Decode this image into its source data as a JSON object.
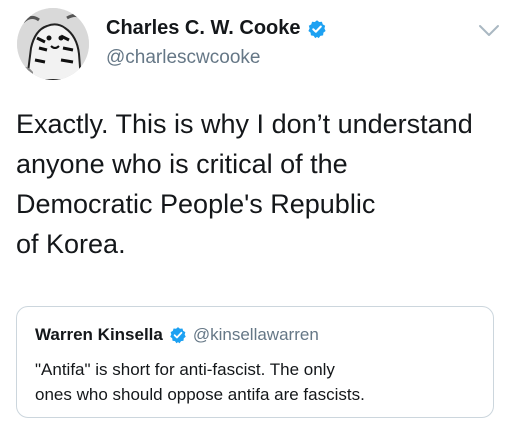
{
  "author": {
    "name": "Charles C. W. Cooke",
    "handle": "@charlescwcooke",
    "verified": true
  },
  "tweet": {
    "lines": [
      "Exactly. This is why I don’t understand",
      "anyone who is critical of the",
      "Democratic People's Republic",
      "of Korea."
    ]
  },
  "quoted_tweet": {
    "name": "Warren Kinsella",
    "handle": "@kinsellawarren",
    "verified": true,
    "lines": [
      "\"Antifa\" is short for anti-fascist. The only",
      "ones who should oppose antifa are fascists."
    ]
  },
  "colors": {
    "verified_blue": "#1da1f2",
    "handle_gray": "#657786",
    "text": "#14171a",
    "border": "#ccd6dd"
  },
  "icons": {
    "verified": "verified-badge-icon",
    "more": "chevron-down-icon"
  }
}
